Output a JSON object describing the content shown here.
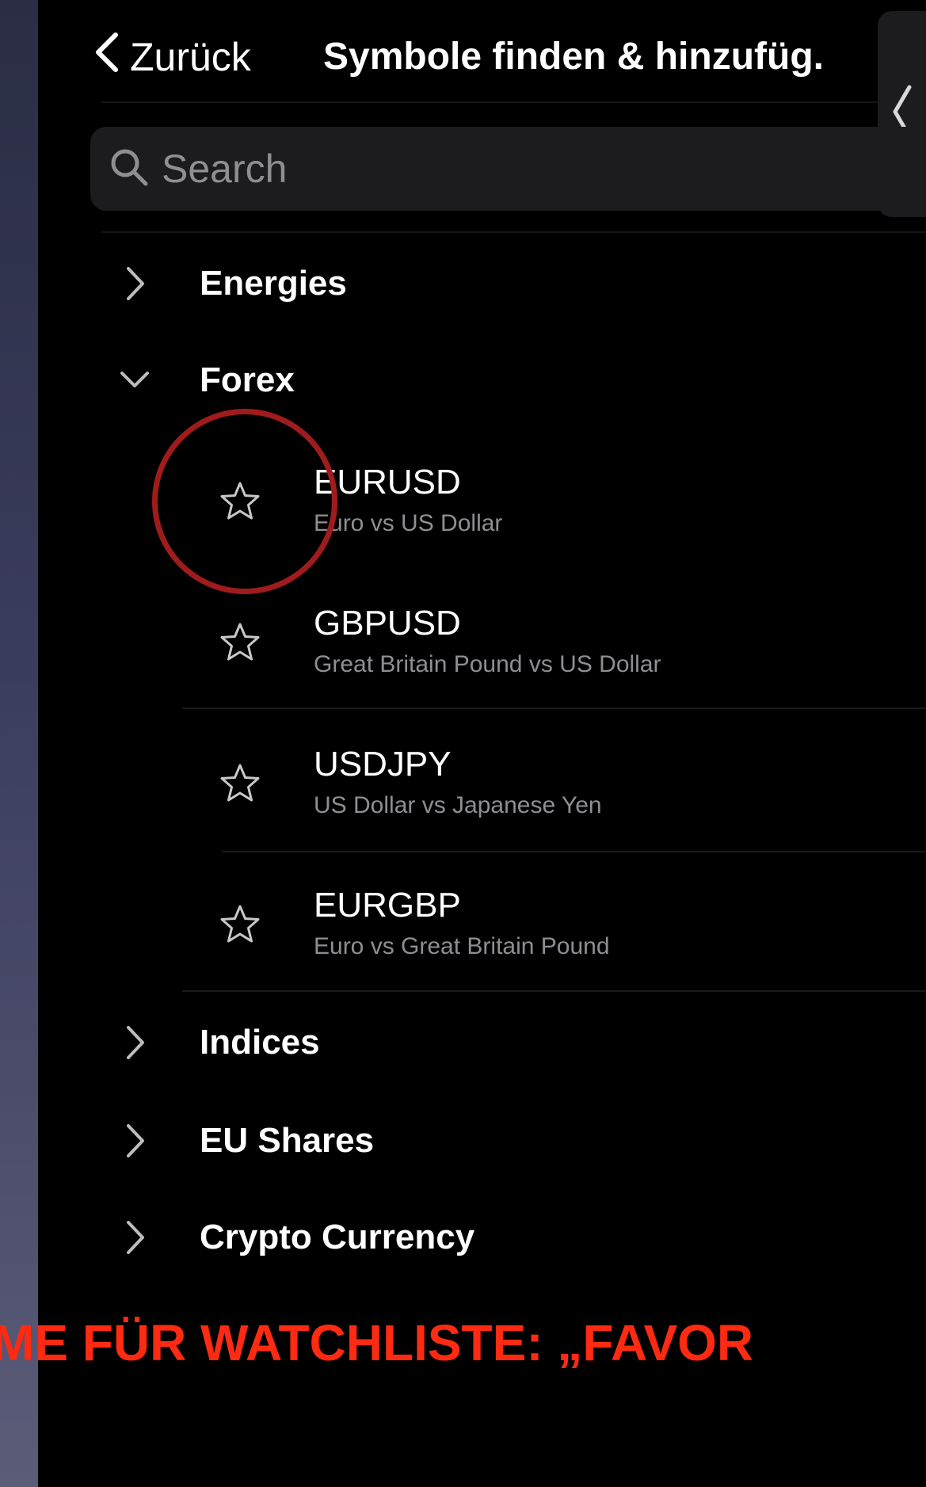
{
  "header": {
    "back_label": "Zurück",
    "title": "Symbole finden & hinzufüg."
  },
  "search": {
    "placeholder": "Search",
    "value": ""
  },
  "categories": [
    {
      "label": "Energies",
      "expanded": false
    },
    {
      "label": "Forex",
      "expanded": true
    },
    {
      "label": "Indices",
      "expanded": false
    },
    {
      "label": "EU Shares",
      "expanded": false
    },
    {
      "label": "Crypto Currency",
      "expanded": false
    }
  ],
  "forex_symbols": [
    {
      "code": "EURUSD",
      "description": "Euro vs US Dollar",
      "favorite": false
    },
    {
      "code": "GBPUSD",
      "description": "Great Britain Pound vs US Dollar",
      "favorite": false
    },
    {
      "code": "USDJPY",
      "description": "US Dollar vs Japanese Yen",
      "favorite": false
    },
    {
      "code": "EURGBP",
      "description": "Euro vs Great Britain Pound",
      "favorite": false
    }
  ],
  "overlay_caption": "ME FÜR WATCHLISTE: „FAVOR",
  "colors": {
    "background": "#000000",
    "text": "#ffffff",
    "secondary_text": "#8e8e93",
    "search_bg": "#1c1c1e",
    "highlight_circle": "#a01c1c",
    "caption": "#ff2a12"
  },
  "icons": {
    "back": "chevron-left-icon",
    "search": "magnifier-icon",
    "collapsed": "chevron-right-icon",
    "expanded": "chevron-down-icon",
    "favorite": "star-outline-icon",
    "side_panel": "chevron-left-icon"
  }
}
